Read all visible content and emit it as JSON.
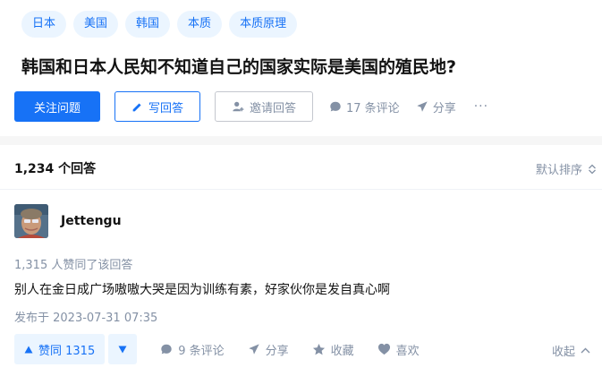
{
  "question": {
    "topics": [
      "日本",
      "美国",
      "韩国",
      "本质",
      "本质原理"
    ],
    "title": "韩国和日本人民知不知道自己的国家实际是美国的殖民地?",
    "follow_label": "关注问题",
    "write_answer_label": "写回答",
    "invite_label": "邀请回答",
    "comments_label": "17 条评论",
    "share_label": "分享",
    "more_label": "···"
  },
  "answers_header": {
    "count_label": "1,234 个回答",
    "sort_label": "默认排序"
  },
  "answer": {
    "author": "Jettengu",
    "voters_text": "1,315 人赞同了该回答",
    "content": "别人在金日成广场嗷嗷大哭是因为训练有素，好家伙你是发自真心啊",
    "published": "发布于 2023-07-31 07:35",
    "upvote_label": "赞同 1315",
    "comments_label": "9 条评论",
    "share_label": "分享",
    "collect_label": "收藏",
    "like_label": "喜欢",
    "collapse_label": "收起"
  },
  "colors": {
    "accent": "#1772f6",
    "accent_bg": "#ebf5ff",
    "muted": "#8491a5",
    "divider": "#f6f6f6"
  },
  "icons": [
    "pencil-icon",
    "invite-user-icon",
    "comment-bubble-icon",
    "share-plane-icon",
    "sort-chevrons-icon",
    "triangle-up-icon",
    "triangle-down-icon",
    "star-icon",
    "heart-icon",
    "chevron-up-icon"
  ]
}
